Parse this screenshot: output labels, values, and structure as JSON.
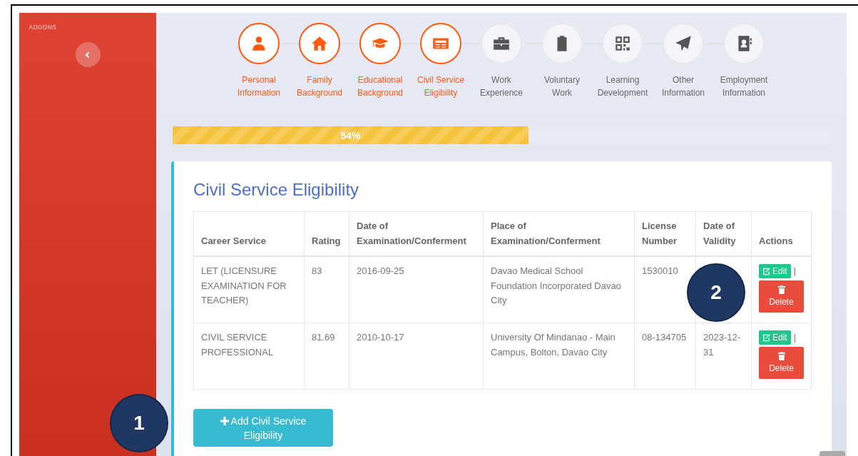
{
  "sidebar": {
    "heading": "ADDONS"
  },
  "steps": [
    {
      "line1": "Personal",
      "line2": "Information",
      "done": true
    },
    {
      "line1": "Family",
      "line2": "Background",
      "done": true
    },
    {
      "line1": "Educational",
      "line2": "Background",
      "done": true
    },
    {
      "line1": "Civil Service",
      "line2": "Eligibility",
      "done": true
    },
    {
      "line1": "Work",
      "line2": "Experience",
      "done": false
    },
    {
      "line1": "Voluntary",
      "line2": "Work",
      "done": false
    },
    {
      "line1": "Learning",
      "line2": "Development",
      "done": false
    },
    {
      "line1": "Other",
      "line2": "Information",
      "done": false
    },
    {
      "line1": "Employment",
      "line2": "Information",
      "done": false
    }
  ],
  "progress": {
    "level": 0.54,
    "label": "54%"
  },
  "card": {
    "title": "Civil Service Eligibility",
    "table": {
      "columns": [
        [
          "Career Service"
        ],
        [
          "Rating"
        ],
        [
          "Date of",
          "Examination/Conferment"
        ],
        [
          "Place of",
          "Examination/Conferment"
        ],
        [
          "License",
          "Number"
        ],
        [
          "Date of",
          "Validity"
        ],
        [
          "Actions"
        ]
      ],
      "rows": [
        {
          "career_service": "LET (LICENSURE EXAMINATION FOR TEACHER)",
          "rating": "83",
          "date_of_examination": "2016-09-25",
          "place_of_examination": "Davao Medical School Foundation Incorporated Davao City",
          "license_number": "1530010",
          "actions": {
            "edit": "Edit",
            "separator": "|",
            "delete": "Delete"
          }
        },
        {
          "career_service": "CIVIL SERVICE PROFESSIONAL",
          "rating": "81.69",
          "date_of_examination": "2010-10-17",
          "place_of_examination": "University Of Mindanao - Main Campus, Bolton, Davao City",
          "license_number": "08-134705",
          "date_of_validity": "2023-12-31",
          "actions": {
            "edit": "Edit",
            "separator": "|",
            "delete": "Delete"
          }
        }
      ]
    },
    "add_button": {
      "line1": "Add Civil Service",
      "line2": "Eligibility"
    }
  },
  "callouts": [
    {
      "label": "1"
    },
    {
      "label": "2"
    }
  ]
}
